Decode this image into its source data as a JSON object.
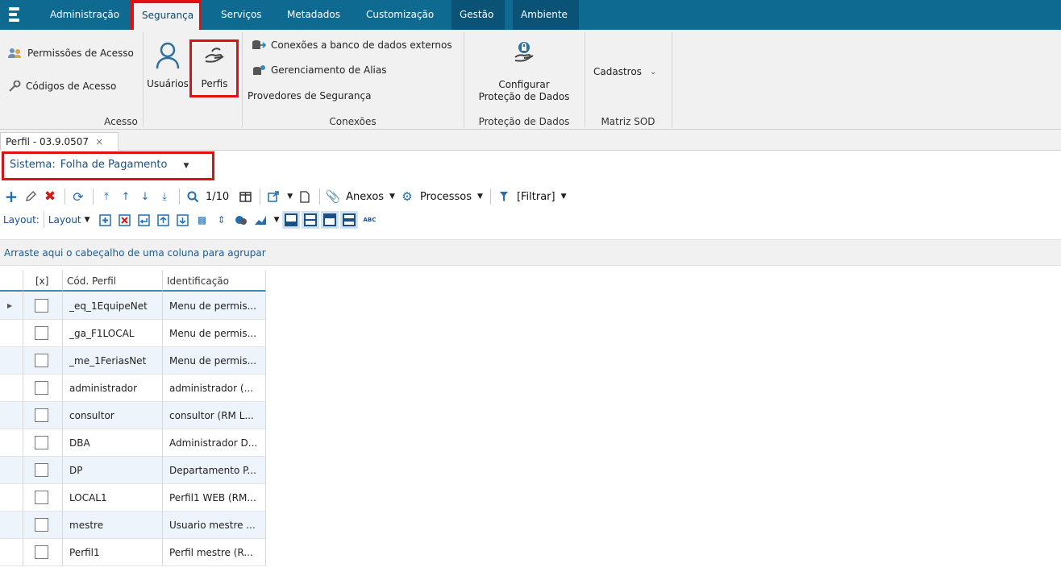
{
  "menubar": {
    "tabs": [
      "Administração",
      "Segurança",
      "Serviços",
      "Metadados",
      "Customização",
      "Gestão",
      "Ambiente"
    ],
    "active": "Segurança"
  },
  "ribbon": {
    "acesso": {
      "permissoes": "Permissões de Acesso",
      "codigos": "Códigos de Acesso",
      "usuarios": "Usuários",
      "perfis": "Perfis",
      "label": "Acesso"
    },
    "conexoes": {
      "bd_externos": "Conexões a banco de dados externos",
      "alias": "Gerenciamento de Alias",
      "provedores": "Provedores de Segurança",
      "label": "Conexões"
    },
    "protecao": {
      "configurar_l1": "Configurar",
      "configurar_l2": "Proteção de Dados",
      "label": "Proteção de Dados"
    },
    "matriz": {
      "cadastros": "Cadastros",
      "label": "Matriz SOD"
    }
  },
  "doc_tab": {
    "title": "Perfil - 03.9.0507",
    "close": "×"
  },
  "sistema": {
    "label": "Sistema:",
    "value": "Folha de Pagamento"
  },
  "toolbar": {
    "counter": "1/10",
    "anexos": "Anexos",
    "processos": "Processos",
    "filtrar": "[Filtrar]"
  },
  "layoutbar": {
    "label": "Layout:",
    "menu": "Layout",
    "abc": "ABC"
  },
  "groupbar": {
    "hint": "Arraste aqui o cabeçalho de uma coluna para agrupar"
  },
  "grid": {
    "headers": [
      "[x]",
      "Cód. Perfil",
      "Identificação"
    ],
    "rows": [
      {
        "cod": "_eq_1EquipeNet",
        "id": "Menu de permis..."
      },
      {
        "cod": "_ga_F1LOCAL",
        "id": "Menu de permis..."
      },
      {
        "cod": "_me_1FeriasNet",
        "id": "Menu de permis..."
      },
      {
        "cod": "administrador",
        "id": "administrador (..."
      },
      {
        "cod": "consultor",
        "id": "consultor (RM L..."
      },
      {
        "cod": "DBA",
        "id": "Administrador D..."
      },
      {
        "cod": "DP",
        "id": "Departamento P..."
      },
      {
        "cod": "LOCAL1",
        "id": "Perfil1 WEB (RM..."
      },
      {
        "cod": "mestre",
        "id": "Usuario mestre ..."
      },
      {
        "cod": "Perfil1",
        "id": "Perfil mestre (R..."
      }
    ]
  }
}
